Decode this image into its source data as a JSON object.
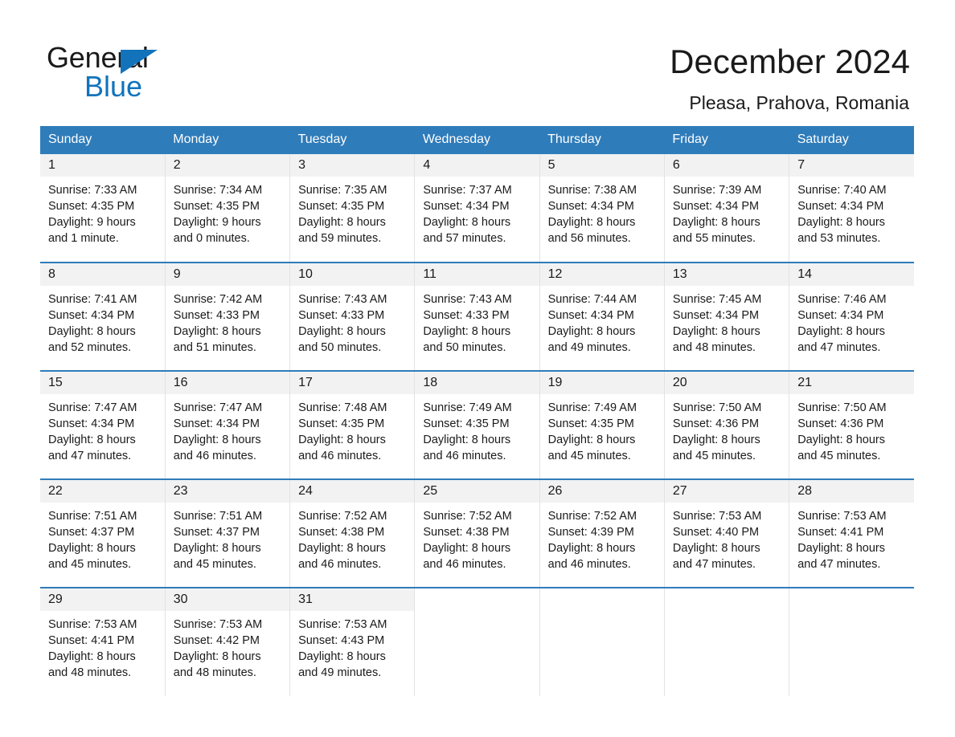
{
  "brand": {
    "name_part1": "General",
    "name_part2": "Blue",
    "accent_color": "#1273bb"
  },
  "header": {
    "title": "December 2024",
    "location": "Pleasa, Prahova, Romania"
  },
  "calendar": {
    "header_bg": "#2f7cba",
    "weekday_headers": [
      "Sunday",
      "Monday",
      "Tuesday",
      "Wednesday",
      "Thursday",
      "Friday",
      "Saturday"
    ],
    "weeks": [
      [
        {
          "day": "1",
          "sunrise": "Sunrise: 7:33 AM",
          "sunset": "Sunset: 4:35 PM",
          "daylight1": "Daylight: 9 hours",
          "daylight2": "and 1 minute."
        },
        {
          "day": "2",
          "sunrise": "Sunrise: 7:34 AM",
          "sunset": "Sunset: 4:35 PM",
          "daylight1": "Daylight: 9 hours",
          "daylight2": "and 0 minutes."
        },
        {
          "day": "3",
          "sunrise": "Sunrise: 7:35 AM",
          "sunset": "Sunset: 4:35 PM",
          "daylight1": "Daylight: 8 hours",
          "daylight2": "and 59 minutes."
        },
        {
          "day": "4",
          "sunrise": "Sunrise: 7:37 AM",
          "sunset": "Sunset: 4:34 PM",
          "daylight1": "Daylight: 8 hours",
          "daylight2": "and 57 minutes."
        },
        {
          "day": "5",
          "sunrise": "Sunrise: 7:38 AM",
          "sunset": "Sunset: 4:34 PM",
          "daylight1": "Daylight: 8 hours",
          "daylight2": "and 56 minutes."
        },
        {
          "day": "6",
          "sunrise": "Sunrise: 7:39 AM",
          "sunset": "Sunset: 4:34 PM",
          "daylight1": "Daylight: 8 hours",
          "daylight2": "and 55 minutes."
        },
        {
          "day": "7",
          "sunrise": "Sunrise: 7:40 AM",
          "sunset": "Sunset: 4:34 PM",
          "daylight1": "Daylight: 8 hours",
          "daylight2": "and 53 minutes."
        }
      ],
      [
        {
          "day": "8",
          "sunrise": "Sunrise: 7:41 AM",
          "sunset": "Sunset: 4:34 PM",
          "daylight1": "Daylight: 8 hours",
          "daylight2": "and 52 minutes."
        },
        {
          "day": "9",
          "sunrise": "Sunrise: 7:42 AM",
          "sunset": "Sunset: 4:33 PM",
          "daylight1": "Daylight: 8 hours",
          "daylight2": "and 51 minutes."
        },
        {
          "day": "10",
          "sunrise": "Sunrise: 7:43 AM",
          "sunset": "Sunset: 4:33 PM",
          "daylight1": "Daylight: 8 hours",
          "daylight2": "and 50 minutes."
        },
        {
          "day": "11",
          "sunrise": "Sunrise: 7:43 AM",
          "sunset": "Sunset: 4:33 PM",
          "daylight1": "Daylight: 8 hours",
          "daylight2": "and 50 minutes."
        },
        {
          "day": "12",
          "sunrise": "Sunrise: 7:44 AM",
          "sunset": "Sunset: 4:34 PM",
          "daylight1": "Daylight: 8 hours",
          "daylight2": "and 49 minutes."
        },
        {
          "day": "13",
          "sunrise": "Sunrise: 7:45 AM",
          "sunset": "Sunset: 4:34 PM",
          "daylight1": "Daylight: 8 hours",
          "daylight2": "and 48 minutes."
        },
        {
          "day": "14",
          "sunrise": "Sunrise: 7:46 AM",
          "sunset": "Sunset: 4:34 PM",
          "daylight1": "Daylight: 8 hours",
          "daylight2": "and 47 minutes."
        }
      ],
      [
        {
          "day": "15",
          "sunrise": "Sunrise: 7:47 AM",
          "sunset": "Sunset: 4:34 PM",
          "daylight1": "Daylight: 8 hours",
          "daylight2": "and 47 minutes."
        },
        {
          "day": "16",
          "sunrise": "Sunrise: 7:47 AM",
          "sunset": "Sunset: 4:34 PM",
          "daylight1": "Daylight: 8 hours",
          "daylight2": "and 46 minutes."
        },
        {
          "day": "17",
          "sunrise": "Sunrise: 7:48 AM",
          "sunset": "Sunset: 4:35 PM",
          "daylight1": "Daylight: 8 hours",
          "daylight2": "and 46 minutes."
        },
        {
          "day": "18",
          "sunrise": "Sunrise: 7:49 AM",
          "sunset": "Sunset: 4:35 PM",
          "daylight1": "Daylight: 8 hours",
          "daylight2": "and 46 minutes."
        },
        {
          "day": "19",
          "sunrise": "Sunrise: 7:49 AM",
          "sunset": "Sunset: 4:35 PM",
          "daylight1": "Daylight: 8 hours",
          "daylight2": "and 45 minutes."
        },
        {
          "day": "20",
          "sunrise": "Sunrise: 7:50 AM",
          "sunset": "Sunset: 4:36 PM",
          "daylight1": "Daylight: 8 hours",
          "daylight2": "and 45 minutes."
        },
        {
          "day": "21",
          "sunrise": "Sunrise: 7:50 AM",
          "sunset": "Sunset: 4:36 PM",
          "daylight1": "Daylight: 8 hours",
          "daylight2": "and 45 minutes."
        }
      ],
      [
        {
          "day": "22",
          "sunrise": "Sunrise: 7:51 AM",
          "sunset": "Sunset: 4:37 PM",
          "daylight1": "Daylight: 8 hours",
          "daylight2": "and 45 minutes."
        },
        {
          "day": "23",
          "sunrise": "Sunrise: 7:51 AM",
          "sunset": "Sunset: 4:37 PM",
          "daylight1": "Daylight: 8 hours",
          "daylight2": "and 45 minutes."
        },
        {
          "day": "24",
          "sunrise": "Sunrise: 7:52 AM",
          "sunset": "Sunset: 4:38 PM",
          "daylight1": "Daylight: 8 hours",
          "daylight2": "and 46 minutes."
        },
        {
          "day": "25",
          "sunrise": "Sunrise: 7:52 AM",
          "sunset": "Sunset: 4:38 PM",
          "daylight1": "Daylight: 8 hours",
          "daylight2": "and 46 minutes."
        },
        {
          "day": "26",
          "sunrise": "Sunrise: 7:52 AM",
          "sunset": "Sunset: 4:39 PM",
          "daylight1": "Daylight: 8 hours",
          "daylight2": "and 46 minutes."
        },
        {
          "day": "27",
          "sunrise": "Sunrise: 7:53 AM",
          "sunset": "Sunset: 4:40 PM",
          "daylight1": "Daylight: 8 hours",
          "daylight2": "and 47 minutes."
        },
        {
          "day": "28",
          "sunrise": "Sunrise: 7:53 AM",
          "sunset": "Sunset: 4:41 PM",
          "daylight1": "Daylight: 8 hours",
          "daylight2": "and 47 minutes."
        }
      ],
      [
        {
          "day": "29",
          "sunrise": "Sunrise: 7:53 AM",
          "sunset": "Sunset: 4:41 PM",
          "daylight1": "Daylight: 8 hours",
          "daylight2": "and 48 minutes."
        },
        {
          "day": "30",
          "sunrise": "Sunrise: 7:53 AM",
          "sunset": "Sunset: 4:42 PM",
          "daylight1": "Daylight: 8 hours",
          "daylight2": "and 48 minutes."
        },
        {
          "day": "31",
          "sunrise": "Sunrise: 7:53 AM",
          "sunset": "Sunset: 4:43 PM",
          "daylight1": "Daylight: 8 hours",
          "daylight2": "and 49 minutes."
        },
        {
          "day": "",
          "sunrise": "",
          "sunset": "",
          "daylight1": "",
          "daylight2": ""
        },
        {
          "day": "",
          "sunrise": "",
          "sunset": "",
          "daylight1": "",
          "daylight2": ""
        },
        {
          "day": "",
          "sunrise": "",
          "sunset": "",
          "daylight1": "",
          "daylight2": ""
        },
        {
          "day": "",
          "sunrise": "",
          "sunset": "",
          "daylight1": "",
          "daylight2": ""
        }
      ]
    ]
  }
}
